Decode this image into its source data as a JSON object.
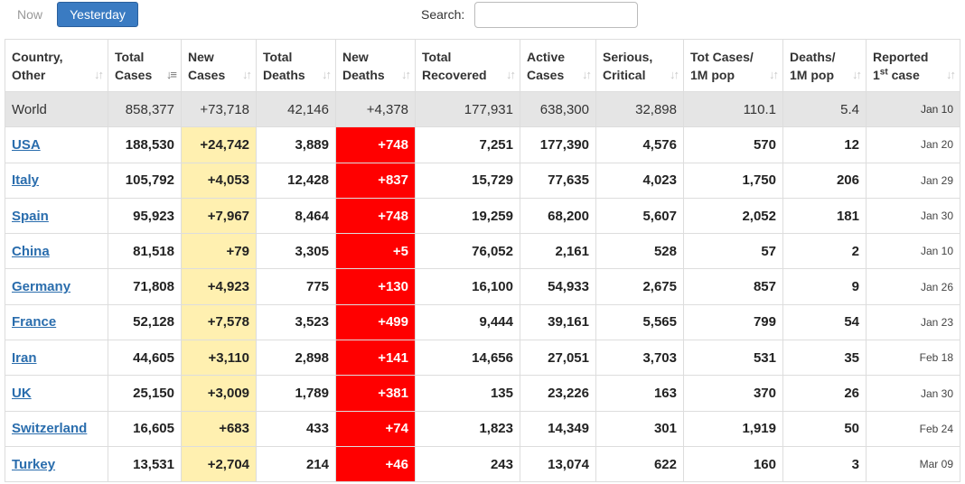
{
  "controls": {
    "now_label": "Now",
    "yesterday_label": "Yesterday",
    "search_label": "Search:",
    "search_value": "",
    "search_placeholder": ""
  },
  "columns": [
    {
      "line1": "Country,",
      "line2": "Other",
      "sup": ""
    },
    {
      "line1": "Total",
      "line2": "Cases",
      "sup": "",
      "sorted": true
    },
    {
      "line1": "New",
      "line2": "Cases",
      "sup": ""
    },
    {
      "line1": "Total",
      "line2": "Deaths",
      "sup": ""
    },
    {
      "line1": "New",
      "line2": "Deaths",
      "sup": ""
    },
    {
      "line1": "Total",
      "line2": "Recovered",
      "sup": ""
    },
    {
      "line1": "Active",
      "line2": "Cases",
      "sup": ""
    },
    {
      "line1": "Serious,",
      "line2": "Critical",
      "sup": ""
    },
    {
      "line1": "Tot Cases/",
      "line2": "1M pop",
      "sup": ""
    },
    {
      "line1": "Deaths/",
      "line2": "1M pop",
      "sup": ""
    },
    {
      "line1": "Reported",
      "line2": " case",
      "sup": "st",
      "prefix": "1"
    }
  ],
  "world": [
    "World",
    "858,377",
    "+73,718",
    "42,146",
    "+4,378",
    "177,931",
    "638,300",
    "32,898",
    "110.1",
    "5.4",
    "Jan 10"
  ],
  "rows": [
    [
      "USA",
      "188,530",
      "+24,742",
      "3,889",
      "+748",
      "7,251",
      "177,390",
      "4,576",
      "570",
      "12",
      "Jan 20"
    ],
    [
      "Italy",
      "105,792",
      "+4,053",
      "12,428",
      "+837",
      "15,729",
      "77,635",
      "4,023",
      "1,750",
      "206",
      "Jan 29"
    ],
    [
      "Spain",
      "95,923",
      "+7,967",
      "8,464",
      "+748",
      "19,259",
      "68,200",
      "5,607",
      "2,052",
      "181",
      "Jan 30"
    ],
    [
      "China",
      "81,518",
      "+79",
      "3,305",
      "+5",
      "76,052",
      "2,161",
      "528",
      "57",
      "2",
      "Jan 10"
    ],
    [
      "Germany",
      "71,808",
      "+4,923",
      "775",
      "+130",
      "16,100",
      "54,933",
      "2,675",
      "857",
      "9",
      "Jan 26"
    ],
    [
      "France",
      "52,128",
      "+7,578",
      "3,523",
      "+499",
      "9,444",
      "39,161",
      "5,565",
      "799",
      "54",
      "Jan 23"
    ],
    [
      "Iran",
      "44,605",
      "+3,110",
      "2,898",
      "+141",
      "14,656",
      "27,051",
      "3,703",
      "531",
      "35",
      "Feb 18"
    ],
    [
      "UK",
      "25,150",
      "+3,009",
      "1,789",
      "+381",
      "135",
      "23,226",
      "163",
      "370",
      "26",
      "Jan 30"
    ],
    [
      "Switzerland",
      "16,605",
      "+683",
      "433",
      "+74",
      "1,823",
      "14,349",
      "301",
      "1,919",
      "50",
      "Feb 24"
    ],
    [
      "Turkey",
      "13,531",
      "+2,704",
      "214",
      "+46",
      "243",
      "13,074",
      "622",
      "160",
      "3",
      "Mar 09"
    ]
  ],
  "colors": {
    "new_cases_bg": "#fff0b0",
    "new_deaths_bg": "#ff0000",
    "world_bg": "#e5e5e5",
    "active_button": "#3a7bc2",
    "link": "#2a6dad"
  },
  "icons": {
    "sort": "sort-icon",
    "sort_active": "sort-desc-icon"
  }
}
